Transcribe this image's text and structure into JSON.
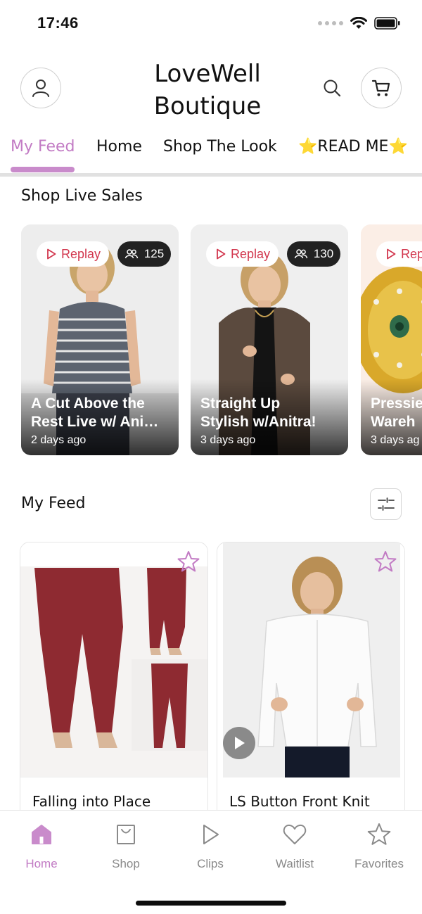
{
  "status_bar": {
    "time": "17:46"
  },
  "header": {
    "brand_line1": "LoveWell",
    "brand_line2": "Boutique",
    "icons": [
      "profile-icon",
      "search-icon",
      "cart-icon"
    ]
  },
  "tabs": [
    {
      "label": "My Feed",
      "active": true
    },
    {
      "label": "Home",
      "active": false
    },
    {
      "label": "Shop The Look",
      "active": false
    },
    {
      "label": "⭐READ ME⭐",
      "active": false
    }
  ],
  "live_sales": {
    "heading": "Shop Live Sales",
    "cards": [
      {
        "replay_label": "Replay",
        "viewers": "125",
        "title_line1": "A Cut Above the",
        "title_line2": "Rest Live w/ Ani…",
        "date": "2 days ago"
      },
      {
        "replay_label": "Replay",
        "viewers": "130",
        "title_line1": "Straight Up",
        "title_line2": "Stylish w/Anitra!",
        "date": "3 days ago"
      },
      {
        "replay_label": "Rep",
        "viewers": "",
        "title_line1": "Pressie",
        "title_line2": "Wareh",
        "date": "3 days ag"
      }
    ]
  },
  "feed": {
    "heading": "My Feed",
    "items": [
      {
        "title": "Falling into Place",
        "has_video": false
      },
      {
        "title": "LS Button Front Knit",
        "has_video": true
      }
    ]
  },
  "bottom_nav": [
    {
      "label": "Home",
      "icon": "home-icon",
      "active": true
    },
    {
      "label": "Shop",
      "icon": "shopping-bag-icon",
      "active": false
    },
    {
      "label": "Clips",
      "icon": "play-icon",
      "active": false
    },
    {
      "label": "Waitlist",
      "icon": "heart-icon",
      "active": false
    },
    {
      "label": "Favorites",
      "icon": "star-icon",
      "active": false
    }
  ],
  "colors": {
    "accent": "#c27bc4",
    "replay_red": "#d2374e",
    "pill_dark": "#222222"
  }
}
